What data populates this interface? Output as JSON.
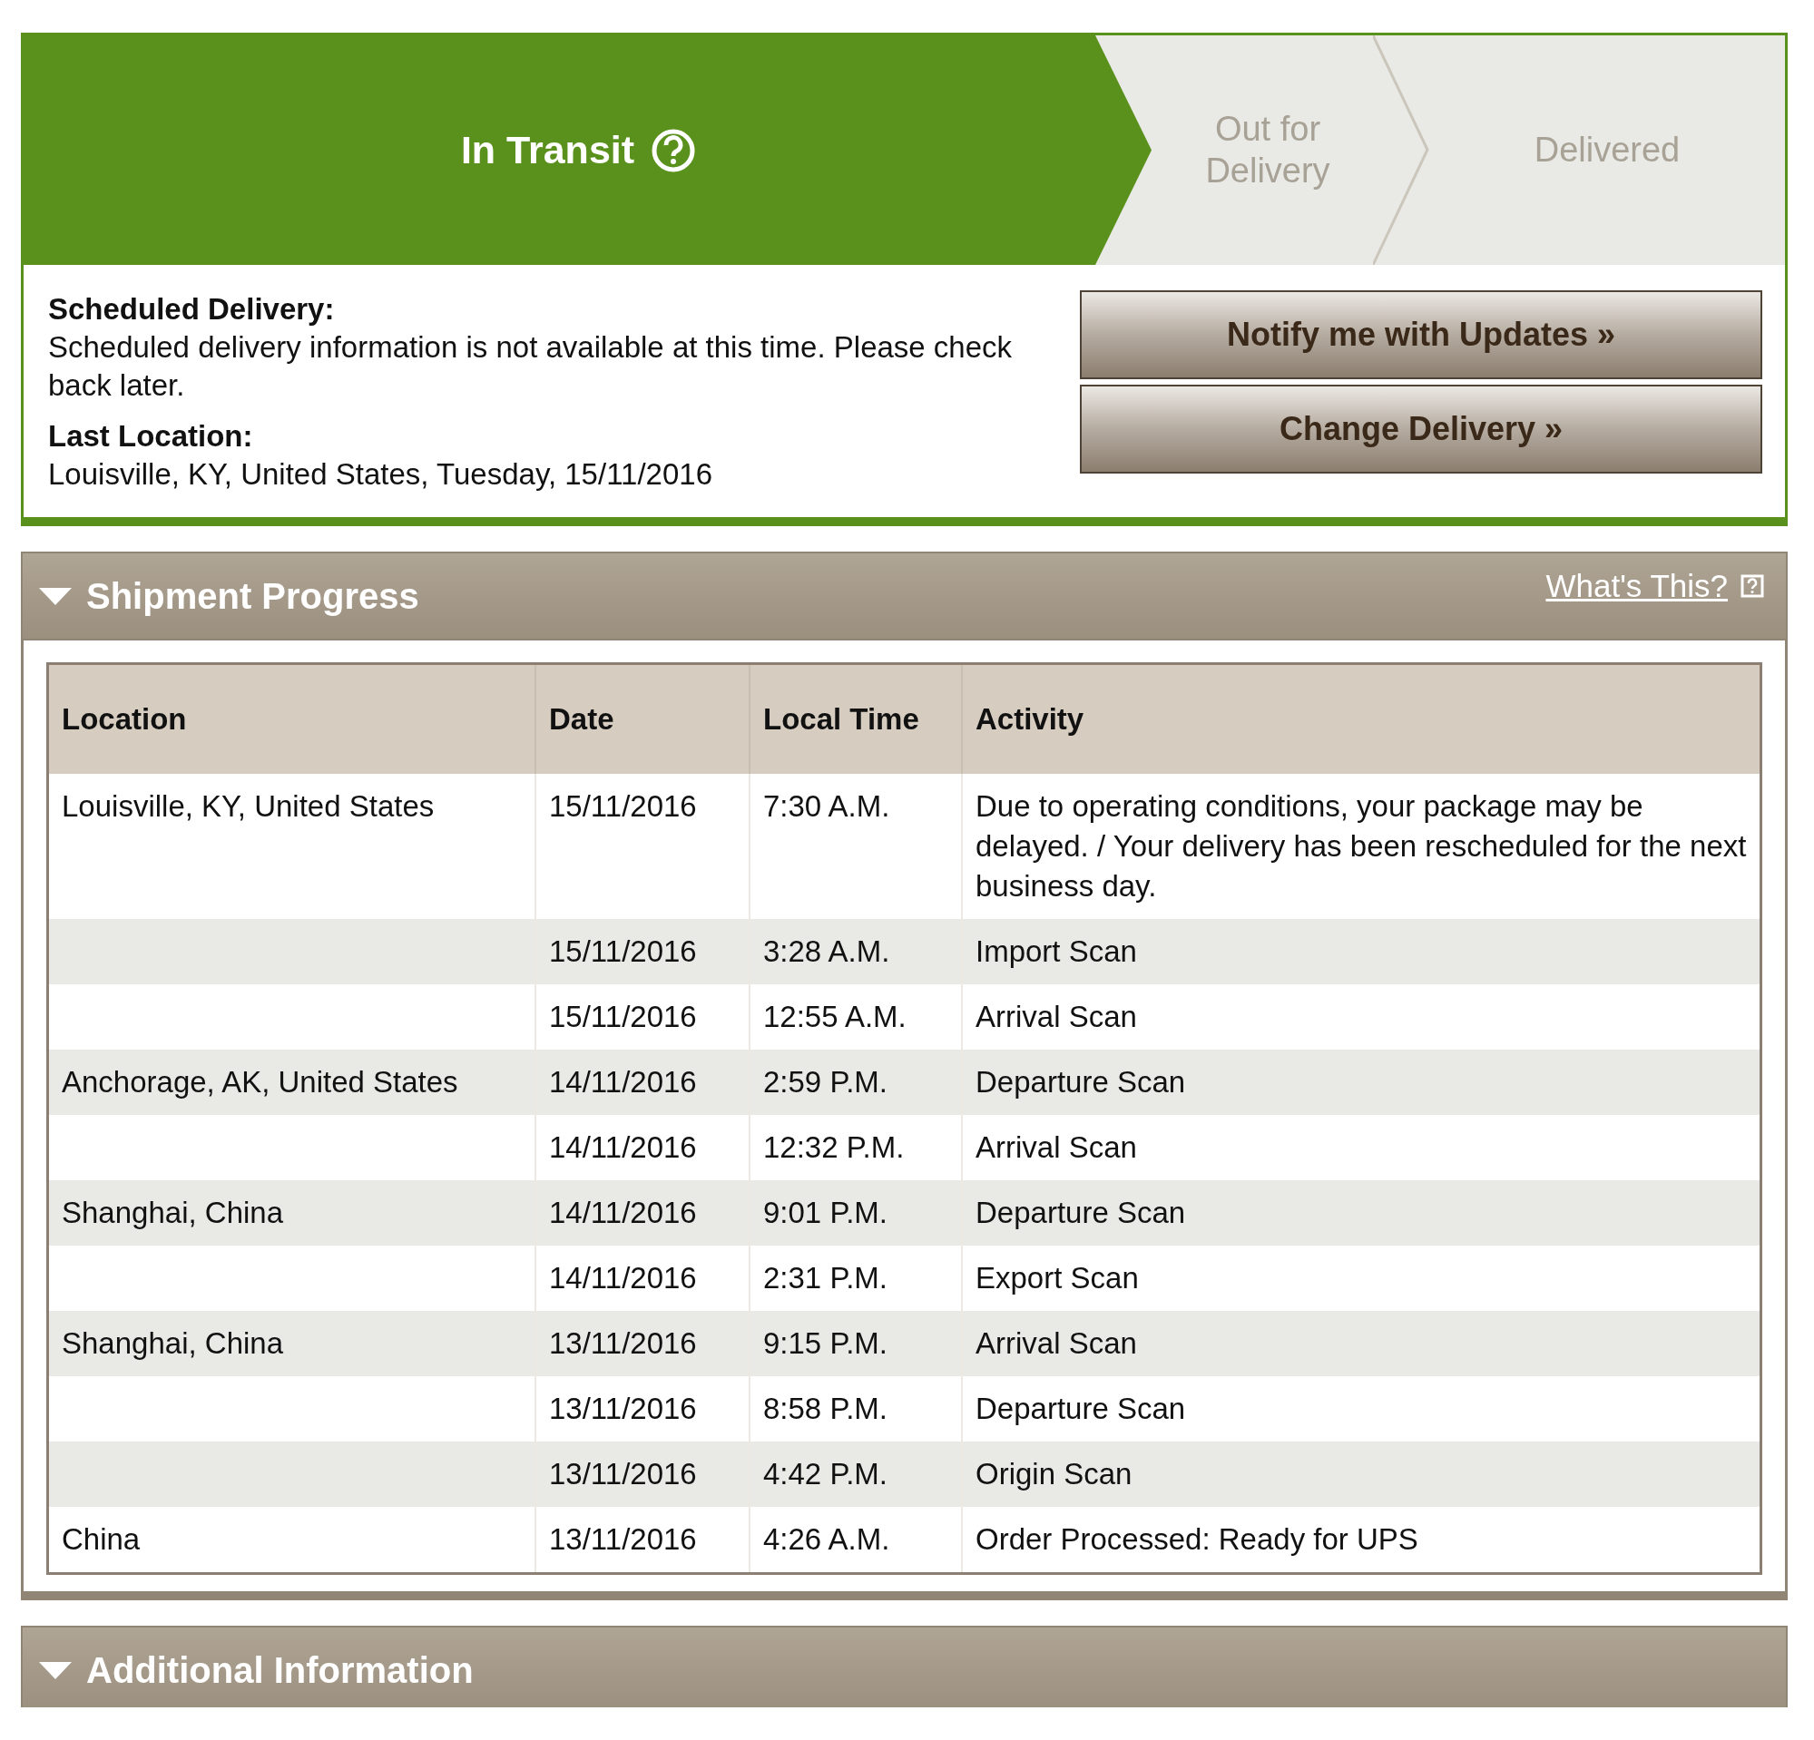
{
  "status": {
    "steps": [
      {
        "label": "In Transit",
        "selected": true
      },
      {
        "label": "Out for Delivery",
        "selected": false
      },
      {
        "label": "Delivered",
        "selected": false
      }
    ],
    "scheduled_label": "Scheduled Delivery:",
    "scheduled_text": "Scheduled delivery information is not available at this time. Please check back later.",
    "last_location_label": "Last Location:",
    "last_location": "Louisville, KY, United States, Tuesday, 15/11/2016",
    "buttons": [
      "Notify me with Updates »",
      "Change Delivery »"
    ]
  },
  "shipment_progress": {
    "title": "Shipment Progress",
    "expanded": true,
    "link": "What's This?",
    "table": {
      "columns": [
        "Location",
        "Date",
        "Local Time",
        "Activity"
      ],
      "rows": [
        [
          "Louisville, KY, United States",
          "15/11/2016",
          "7:30 A.M.",
          "Due to operating conditions, your package may be delayed. / Your delivery has been rescheduled for the next business day."
        ],
        [
          "",
          "15/11/2016",
          "3:28 A.M.",
          "Import Scan"
        ],
        [
          "",
          "15/11/2016",
          "12:55 A.M.",
          "Arrival Scan"
        ],
        [
          "Anchorage, AK, United States",
          "14/11/2016",
          "2:59 P.M.",
          "Departure Scan"
        ],
        [
          "",
          "14/11/2016",
          "12:32 P.M.",
          "Arrival Scan"
        ],
        [
          "Shanghai, China",
          "14/11/2016",
          "9:01 P.M.",
          "Departure Scan"
        ],
        [
          "",
          "14/11/2016",
          "2:31 P.M.",
          "Export Scan"
        ],
        [
          "Shanghai, China",
          "13/11/2016",
          "9:15 P.M.",
          "Arrival Scan"
        ],
        [
          "",
          "13/11/2016",
          "8:58 P.M.",
          "Departure Scan"
        ],
        [
          "",
          "13/11/2016",
          "4:42 P.M.",
          "Origin Scan"
        ],
        [
          "China",
          "13/11/2016",
          "4:26 A.M.",
          "Order Processed: Ready for UPS"
        ]
      ]
    }
  },
  "additional_information": {
    "title": "Additional Information",
    "expanded": true
  }
}
